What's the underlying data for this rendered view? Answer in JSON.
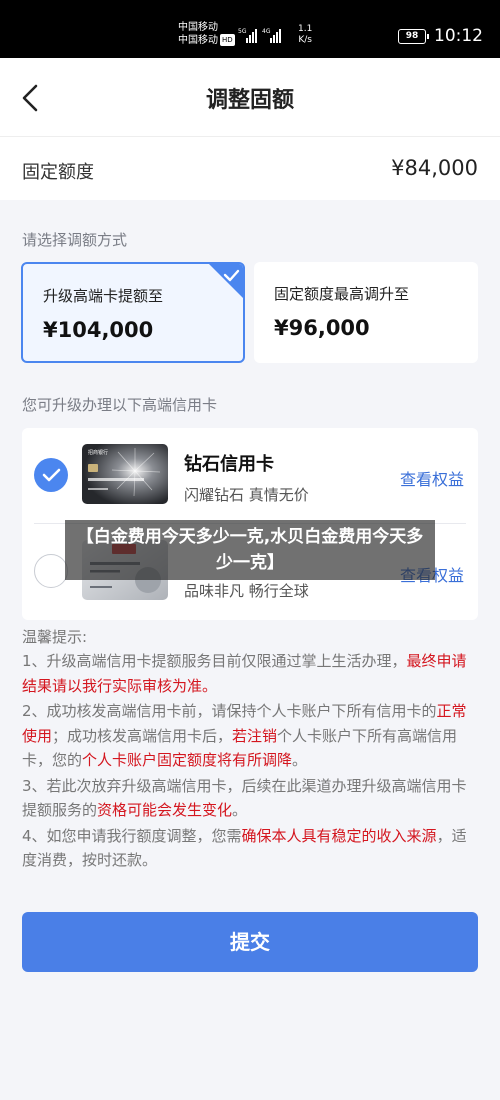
{
  "status_bar": {
    "carrier_1": "中国移动",
    "carrier_2": "中国移动",
    "hd_badge": "HD",
    "network_1": "5G",
    "network_2": "4G",
    "speed_value": "1.1",
    "speed_unit": "K/s",
    "battery": "98",
    "time": "10:12"
  },
  "header": {
    "title": "调整固额",
    "back_icon": "chevron-left-icon"
  },
  "fixed_limit": {
    "label": "固定额度",
    "value": "¥84,000"
  },
  "adjust_section": {
    "label": "请选择调额方式",
    "options": [
      {
        "label": "升级高端卡提额至",
        "value": "¥104,000",
        "selected": true
      },
      {
        "label": "固定额度最高调升至",
        "value": "¥96,000",
        "selected": false
      }
    ]
  },
  "cards_section": {
    "label": "您可升级办理以下高端信用卡",
    "cards": [
      {
        "name": "钻石信用卡",
        "desc": "闪耀钻石 真情无价",
        "link": "查看权益",
        "selected": true,
        "image_text": "招商银行"
      },
      {
        "name": "",
        "desc": "品味非凡 畅行全球",
        "link": "查看权益",
        "selected": false,
        "image_text": ""
      }
    ]
  },
  "overlay_caption": "【白金费用今天多少一克,水贝白金费用今天多少一克】",
  "notice": {
    "title": "温馨提示:",
    "item1_a": "1、升级高端信用卡提额服务目前仅限通过掌上生活办理，",
    "item1_red": "最终申请结果请以我行实际审核为准。",
    "item2_a": "2、成功核发高端信用卡前，请保持个人卡账户下所有信用卡的",
    "item2_red1": "正常使用",
    "item2_b": "；成功核发高端信用卡后，",
    "item2_red2": "若注销",
    "item2_c": "个人卡账户下所有高端信用卡，您的",
    "item2_red3": "个人卡账户固定额度将有所调降",
    "item2_d": "。",
    "item3_a": "3、若此次放弃升级高端信用卡，后续在此渠道办理升级高端信用卡提额服务的",
    "item3_red": "资格可能会发生变化",
    "item3_b": "。",
    "item4_a": "4、如您申请我行额度调整，您需",
    "item4_red": "确保本人具有稳定的收入来源",
    "item4_b": "，适度消费，按时还款。"
  },
  "submit_label": "提交",
  "colors": {
    "accent": "#4a7fe7",
    "link": "#3a6fd8",
    "warning_red": "#d4161f"
  }
}
